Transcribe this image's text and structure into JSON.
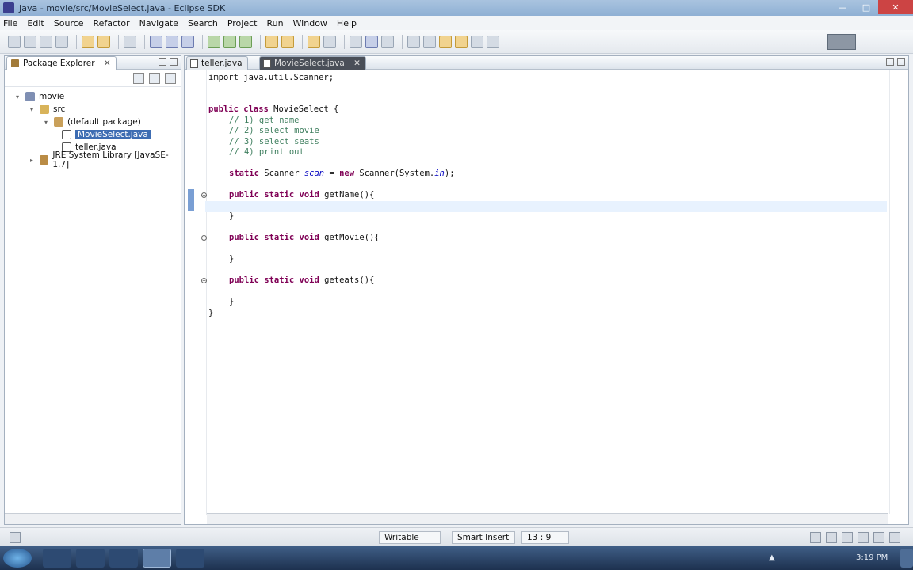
{
  "window": {
    "title": "Java - movie/src/MovieSelect.java - Eclipse SDK",
    "controls": [
      "—",
      "□",
      "✕"
    ]
  },
  "menu": [
    "File",
    "Edit",
    "Source",
    "Refactor",
    "Navigate",
    "Search",
    "Project",
    "Run",
    "Window",
    "Help"
  ],
  "package_explorer": {
    "tab_label": "Package Explorer",
    "tree": [
      {
        "label": "movie"
      },
      {
        "label": "src"
      },
      {
        "label": "(default package)"
      },
      {
        "label": "MovieSelect.java"
      },
      {
        "label": "teller.java"
      },
      {
        "label": "JRE System Library [JavaSE-1.7]"
      }
    ]
  },
  "editor": {
    "tabs": [
      {
        "label": "teller.java"
      },
      {
        "label": "MovieSelect.java"
      }
    ],
    "code": {
      "l1": "import java.util.Scanner;",
      "l3a": "public class",
      "l3b": " MovieSelect {",
      "c1": "// 1) get name",
      "c2": "// 2) select movie",
      "c3": "// 3) select seats",
      "c4": "// 4) print out",
      "s1": "static",
      "s2": " Scanner ",
      "s3": "scan",
      "s4": " = ",
      "s5": "new",
      "s6": " Scanner(System.",
      "s7": "in",
      "s8": ");",
      "m_kw": "public static void",
      "m1": " getName(){",
      "m2": " getMovie(){",
      "m3": " geteats(){",
      "rb": "}"
    }
  },
  "status": {
    "writable": "Writable",
    "insert_mode": "Smart Insert",
    "position": "13 : 9"
  },
  "taskbar": {
    "time": "3:19 PM"
  }
}
